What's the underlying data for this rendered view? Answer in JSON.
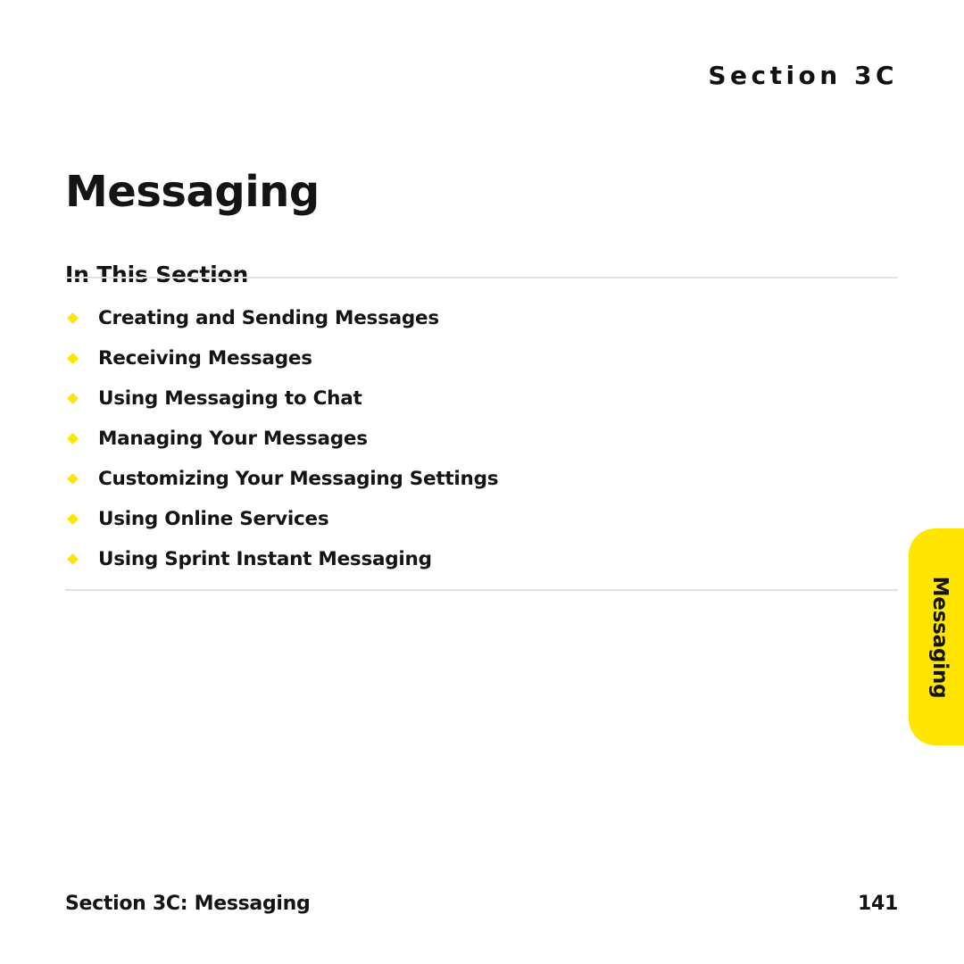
{
  "running_head": "Section 3C",
  "chapter_title": "Messaging",
  "section_heading": "In This Section",
  "toc": {
    "items": [
      {
        "label": "Creating and Sending Messages"
      },
      {
        "label": "Receiving Messages"
      },
      {
        "label": "Using Messaging to Chat"
      },
      {
        "label": "Managing Your Messages"
      },
      {
        "label": "Customizing Your Messaging Settings"
      },
      {
        "label": "Using Online Services"
      },
      {
        "label": "Using Sprint Instant Messaging"
      }
    ]
  },
  "side_tab": {
    "label": "Messaging"
  },
  "footer": {
    "left": "Section 3C: Messaging",
    "page_number": "141"
  },
  "colors": {
    "accent_yellow": "#FFE500",
    "text": "#141414",
    "rule": "#e2e2e2",
    "background": "#ffffff"
  }
}
